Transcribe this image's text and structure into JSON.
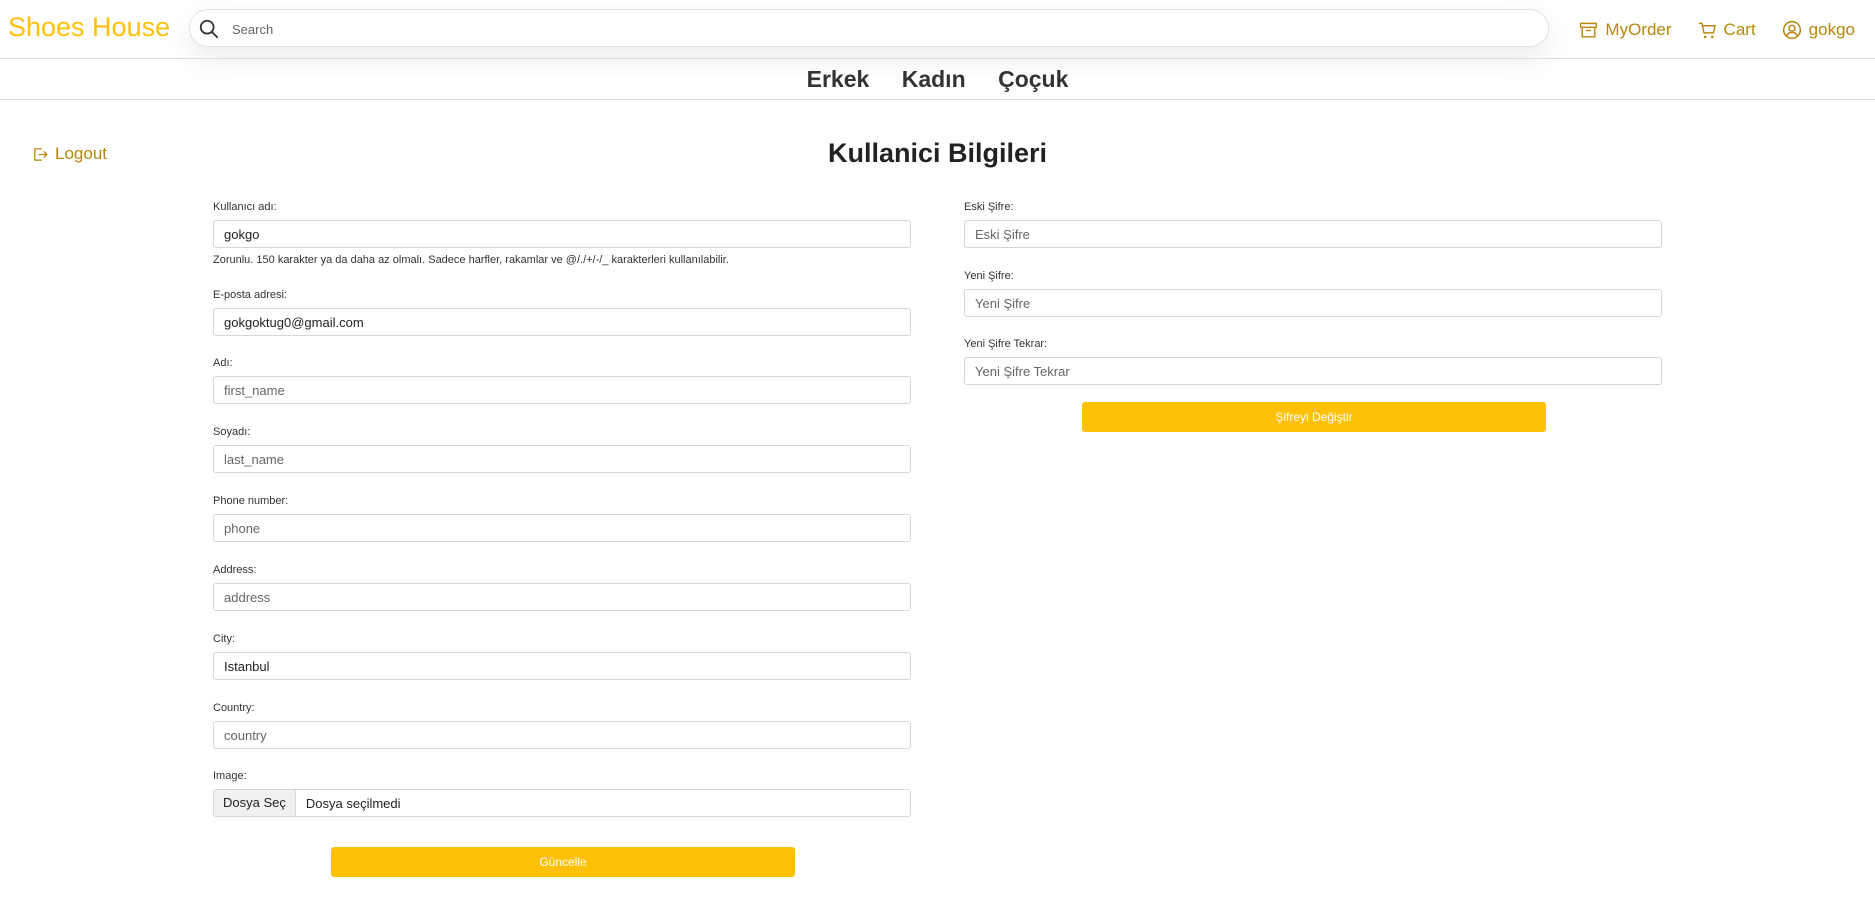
{
  "header": {
    "brand": "Shoes House",
    "search_placeholder": "Search",
    "my_order": "MyOrder",
    "cart": "Cart",
    "username": "gokgo"
  },
  "categories": [
    "Erkek",
    "Kadın",
    "Çoçuk"
  ],
  "sidebar": {
    "logout": "Logout"
  },
  "page_title": "Kullanici Bilgileri",
  "profile_form": {
    "username": {
      "label": "Kullanıcı adı:",
      "value": "gokgo",
      "help": "Zorunlu. 150 karakter ya da daha az olmalı. Sadece harfler, rakamlar ve @/./+/-/_ karakterleri kullanılabilir."
    },
    "email": {
      "label": "E-posta adresi:",
      "value": "gokgoktug0@gmail.com"
    },
    "first_name": {
      "label": "Adı:",
      "placeholder": "first_name"
    },
    "last_name": {
      "label": "Soyadı:",
      "placeholder": "last_name"
    },
    "phone": {
      "label": "Phone number:",
      "placeholder": "phone"
    },
    "address": {
      "label": "Address:",
      "placeholder": "address"
    },
    "city": {
      "label": "City:",
      "value": "Istanbul"
    },
    "country": {
      "label": "Country:",
      "placeholder": "country"
    },
    "image": {
      "label": "Image:",
      "button": "Dosya Seç",
      "status": "Dosya seçilmedi"
    },
    "submit": "Güncelle"
  },
  "password_form": {
    "old": {
      "label": "Eski Şifre:",
      "placeholder": "Eski Şifre"
    },
    "new": {
      "label": "Yeni Şifre:",
      "placeholder": "Yeni Şifre"
    },
    "repeat": {
      "label": "Yeni Şifre Tekrar:",
      "placeholder": "Yeni Şifre Tekrar"
    },
    "submit": "Şifreyi Değiştir"
  },
  "colors": {
    "brand": "#ffc107",
    "link": "#b8860b",
    "button": "#ffc107"
  }
}
